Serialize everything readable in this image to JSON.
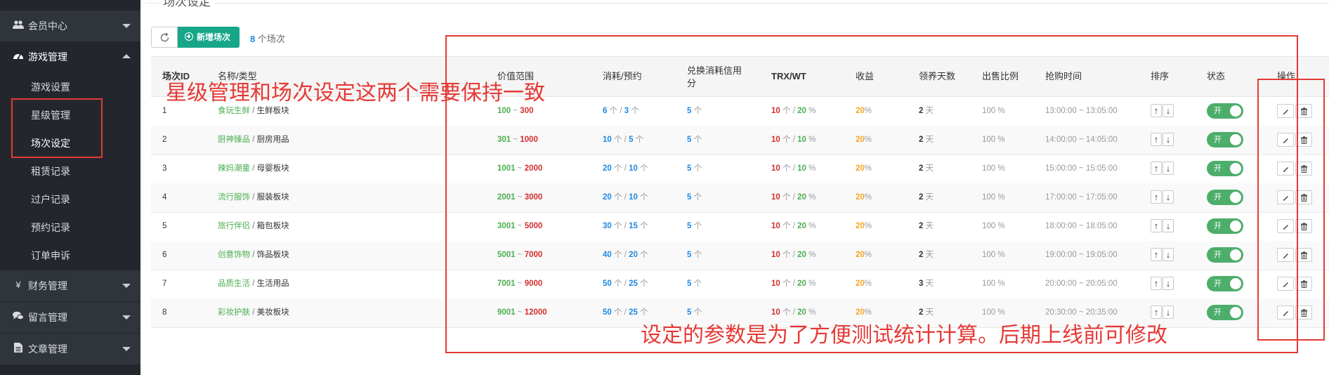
{
  "sidebar": {
    "groups": [
      {
        "label": "会员中心",
        "icon": "users-icon"
      },
      {
        "label": "游戏管理",
        "icon": "dashboard-icon"
      },
      {
        "label": "财务管理",
        "icon": "yen-icon"
      },
      {
        "label": "留言管理",
        "icon": "comments-icon"
      },
      {
        "label": "文章管理",
        "icon": "file-text-icon"
      }
    ],
    "items": [
      {
        "label": "游戏设置"
      },
      {
        "label": "星级管理"
      },
      {
        "label": "场次设定"
      },
      {
        "label": "租赁记录"
      },
      {
        "label": "过户记录"
      },
      {
        "label": "预约记录"
      },
      {
        "label": "订单申诉"
      }
    ]
  },
  "section_title": "场次设定",
  "toolbar": {
    "add_label": "新增场次",
    "count_num": "8",
    "count_text": " 个场次"
  },
  "table": {
    "headers": {
      "id": "场次ID",
      "name": "名称/类型",
      "price": "价值范围",
      "consume": "消耗/预约",
      "credit": "兑换消耗信用分",
      "trxwt": "TRX/WT",
      "income": "收益",
      "days": "领养天数",
      "ratio": "出售比例",
      "time": "抢购时间",
      "sort": "排序",
      "status": "状态",
      "ops": "操作"
    },
    "rows": [
      {
        "id": "1",
        "name": "食玩生鲜",
        "type": "生鲜板块",
        "pmin": "100",
        "pmax": "300",
        "c1": "6",
        "c2": "3",
        "credit": "5",
        "trx": "10",
        "wt": "20",
        "income": "20",
        "days": "2",
        "ratio": "100 %",
        "time": "13:00:00 ~ 13:05:00"
      },
      {
        "id": "2",
        "name": "厨神臻品",
        "type": "厨房用品",
        "pmin": "301",
        "pmax": "1000",
        "c1": "10",
        "c2": "5",
        "credit": "5",
        "trx": "10",
        "wt": "10",
        "income": "20",
        "days": "2",
        "ratio": "100 %",
        "time": "14:00:00 ~ 14:05:00"
      },
      {
        "id": "3",
        "name": "辣妈潮童",
        "type": "母婴板块",
        "pmin": "1001",
        "pmax": "2000",
        "c1": "20",
        "c2": "10",
        "credit": "5",
        "trx": "10",
        "wt": "10",
        "income": "20",
        "days": "2",
        "ratio": "100 %",
        "time": "15:00:00 ~ 15:05:00"
      },
      {
        "id": "4",
        "name": "流行服饰",
        "type": "服装板块",
        "pmin": "2001",
        "pmax": "3000",
        "c1": "20",
        "c2": "10",
        "credit": "5",
        "trx": "10",
        "wt": "20",
        "income": "20",
        "days": "2",
        "ratio": "100 %",
        "time": "17:00:00 ~ 17:05:00"
      },
      {
        "id": "5",
        "name": "旅行伴侣",
        "type": "箱包板块",
        "pmin": "3001",
        "pmax": "5000",
        "c1": "30",
        "c2": "15",
        "credit": "5",
        "trx": "10",
        "wt": "20",
        "income": "20",
        "days": "2",
        "ratio": "100 %",
        "time": "18:00:00 ~ 18:05:00"
      },
      {
        "id": "6",
        "name": "创意饰物",
        "type": "饰品板块",
        "pmin": "5001",
        "pmax": "7000",
        "c1": "40",
        "c2": "20",
        "credit": "5",
        "trx": "10",
        "wt": "20",
        "income": "20",
        "days": "2",
        "ratio": "100 %",
        "time": "19:00:00 ~ 19:05:00"
      },
      {
        "id": "7",
        "name": "品质生活",
        "type": "生活用品",
        "pmin": "7001",
        "pmax": "9000",
        "c1": "50",
        "c2": "25",
        "credit": "5",
        "trx": "10",
        "wt": "20",
        "income": "20",
        "days": "3",
        "ratio": "100 %",
        "time": "20:00:00 ~ 20:05:00"
      },
      {
        "id": "8",
        "name": "彩妆护肤",
        "type": "美妆板块",
        "pmin": "9001",
        "pmax": "12000",
        "c1": "50",
        "c2": "25",
        "credit": "5",
        "trx": "10",
        "wt": "20",
        "income": "20",
        "days": "2",
        "ratio": "100 %",
        "time": "20:30:00 ~ 20:35:00"
      }
    ],
    "units": {
      "ge": "个",
      "day": "天",
      "pct": "%",
      "sep_tilde": " ~ ",
      "sep_slash": " / "
    },
    "toggle_label": "开"
  },
  "annotations": {
    "note1": "星级管理和场次设定这两个需要保持一致",
    "note2": "设定的参数是为了方便测试统计计算。后期上线前可修改"
  },
  "colors": {
    "accent": "#18a689",
    "annotation": "#e53935",
    "sidebar": "#23272d"
  }
}
